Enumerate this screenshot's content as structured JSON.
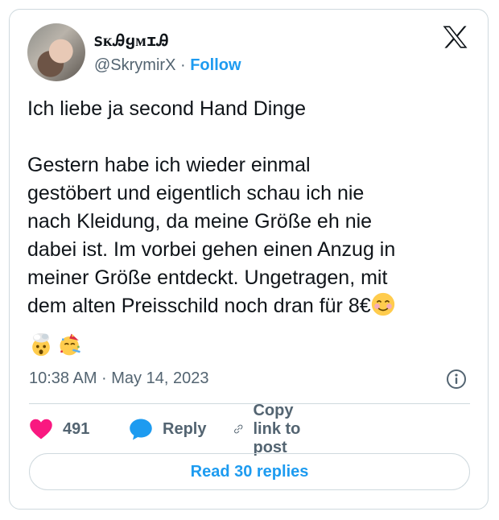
{
  "author": {
    "display_name": "ꜱᴋᎯყᴍɪᎯ",
    "handle": "@SkrymirX",
    "separator": "·",
    "follow_label": "Follow"
  },
  "tweet": {
    "text": "Ich liebe ja second Hand Dinge \n\nGestern habe ich wieder einmal\ngestöbert und eigentlich schau ich nie\nnach Kleidung, da meine Größe eh nie\ndabei ist. Im vorbei gehen einen Anzug in\nmeiner Größe entdeckt. Ungetragen, mit\ndem alten Preisschild noch dran für 8€",
    "emojis": [
      "smiling-face-with-smiling-eyes",
      "exploding-head",
      "partying-face"
    ],
    "timestamp": "10:38 AM · May 14, 2023"
  },
  "actions": {
    "likes": "491",
    "reply_label": "Reply",
    "copy_label": "Copy link to post"
  },
  "read_replies_label": "Read 30 replies",
  "colors": {
    "accent": "#1d9bf0",
    "heart": "#f91880",
    "muted": "#536471",
    "border": "#cfd9de"
  }
}
